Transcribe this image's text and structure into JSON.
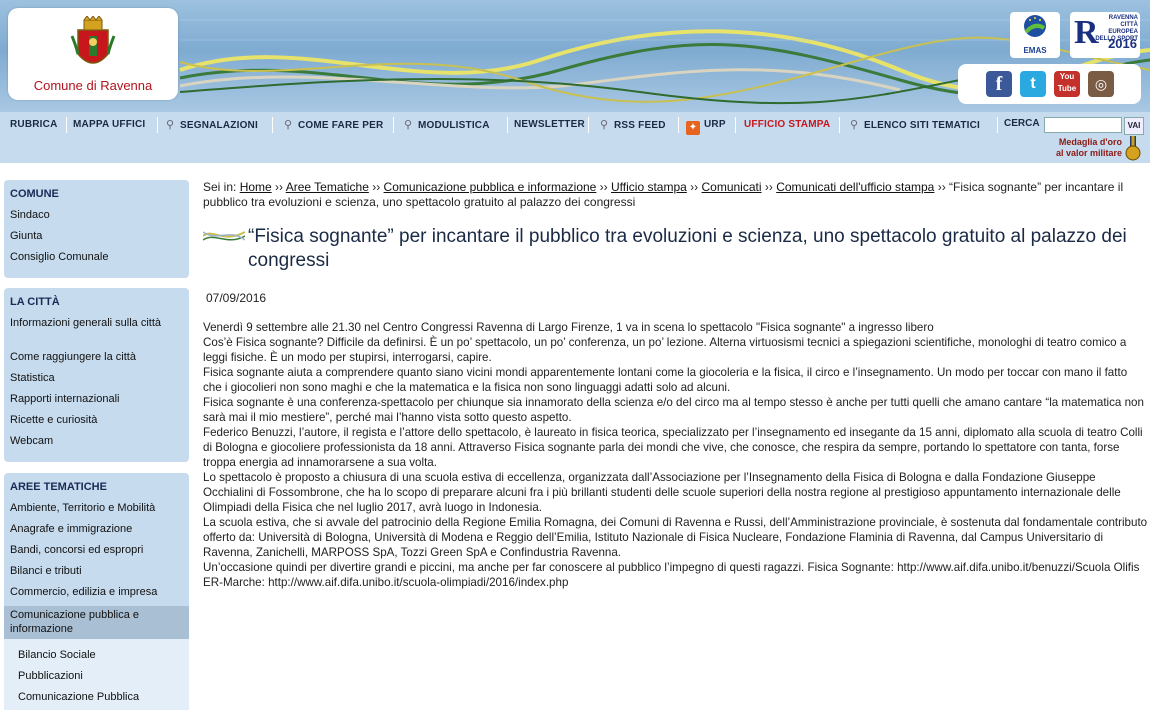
{
  "header": {
    "logo_text": "Comune di Ravenna",
    "emas_label": "EMAS",
    "sport_logo_text": "RAVENNA CITTÀ EUROPEA DELLO SPORT",
    "sport_logo_year": "2016",
    "social": {
      "facebook": "f",
      "twitter": "t",
      "youtube": "You Tube",
      "instagram": "◎"
    }
  },
  "nav": {
    "items": [
      {
        "label": "RUBRICA"
      },
      {
        "label": "MAPPA UFFICI"
      },
      {
        "label": "SEGNALAZIONI"
      },
      {
        "label": "COME FARE PER"
      },
      {
        "label": "MODULISTICA"
      },
      {
        "label": "NEWSLETTER"
      },
      {
        "label": "RSS FEED"
      },
      {
        "label": "URP"
      },
      {
        "label": "UFFICIO STAMPA"
      },
      {
        "label": "ELENCO SITI TEMATICI"
      }
    ],
    "search_label": "CERCA",
    "search_button": "VAI",
    "medaglia_line1": "Medaglia d'oro",
    "medaglia_line2": "al valor militare"
  },
  "sidebar": {
    "comune": {
      "heading": "COMUNE",
      "items": [
        "Sindaco",
        "Giunta",
        "Consiglio Comunale"
      ]
    },
    "citta": {
      "heading": "LA CITTÀ",
      "items": [
        "Informazioni generali sulla città",
        "Come raggiungere la città",
        "Statistica",
        "Rapporti internazionali",
        "Ricette e curiosità",
        "Webcam"
      ]
    },
    "aree": {
      "heading": "AREE TEMATICHE",
      "items": [
        "Ambiente, Territorio e Mobilità",
        "Anagrafe e immigrazione",
        "Bandi, concorsi ed espropri",
        "Bilanci e tributi",
        "Commercio, edilizia e impresa",
        "Comunicazione pubblica e informazione"
      ],
      "subitems": [
        "Bilancio Sociale",
        "Pubblicazioni",
        "Comunicazione Pubblica"
      ]
    }
  },
  "breadcrumb": {
    "prefix": "Sei in:",
    "links": [
      "Home",
      "Aree Tematiche",
      "Comunicazione pubblica e informazione",
      "Ufficio stampa",
      "Comunicati",
      "Comunicati dell'ufficio stampa"
    ],
    "current": "“Fisica sognante” per incantare il pubblico tra evoluzioni e scienza, uno spettacolo gratuito al palazzo dei congressi"
  },
  "article": {
    "title": "“Fisica sognante” per incantare il pubblico tra evoluzioni e scienza, uno spettacolo gratuito al palazzo dei congressi",
    "date": "07/09/2016",
    "paragraphs": [
      "Venerdì 9 settembre alle 21.30 nel Centro Congressi Ravenna di Largo Firenze, 1 va in scena lo spettacolo \"Fisica sognante\" a ingresso libero",
      "Cos’è Fisica sognante? Difficile da definirsi. È un po’ spettacolo, un po’ conferenza, un po’ lezione. Alterna virtuosismi tecnici a spiegazioni scientifiche, monologhi di teatro comico a leggi fisiche. È un modo per stupirsi, interrogarsi, capire.",
      "Fisica sognante aiuta a comprendere quanto siano vicini mondi apparentemente lontani come la giocoleria e la fisica, il circo e l’insegnamento. Un modo per toccar con mano il fatto che i giocolieri non sono maghi e che la matematica e la fisica non sono linguaggi adatti solo ad alcuni.",
      "Fisica sognante è una conferenza-spettacolo per chiunque sia innamorato della scienza e/o del circo ma al tempo stesso è anche per tutti quelli che amano cantare “la matematica non sarà mai il mio mestiere”, perché mai l’hanno vista sotto questo aspetto.",
      "Federico Benuzzi, l’autore, il regista e l’attore dello spettacolo, è laureato in fisica teorica, specializzato per l’insegnamento ed insegante da 15 anni, diplomato alla scuola di teatro Colli di Bologna e giocoliere professionista da 18 anni. Attraverso Fisica sognante parla dei mondi che vive, che conosce, che respira da sempre, portando lo spettatore con tanta, forse troppa energia ad innamorarsene a sua volta.",
      "Lo spettacolo è proposto a chiusura di una scuola estiva di eccellenza, organizzata dall’Associazione per l’Insegnamento della Fisica di Bologna e dalla Fondazione Giuseppe Occhialini di Fossombrone, che ha lo scopo di preparare alcuni fra i più brillanti studenti delle scuole superiori della nostra regione al prestigioso appuntamento internazionale delle Olimpiadi della Fisica che nel luglio 2017, avrà luogo in Indonesia.",
      "La scuola estiva, che si avvale del patrocinio della Regione Emilia Romagna, dei Comuni di Ravenna e Russi, dell’Amministrazione provinciale, è sostenuta dal fondamentale contributo offerto da: Università di Bologna, Università di Modena e Reggio dell’Emilia, Istituto Nazionale di Fisica Nucleare, Fondazione Flaminia di Ravenna, dal Campus Universitario di Ravenna, Zanichelli, MARPOSS SpA, Tozzi Green SpA e Confindustria Ravenna.",
      "Un’occasione quindi per divertire grandi e piccini, ma anche per far conoscere al pubblico l’impegno di questi ragazzi. Fisica Sognante: http://www.aif.difa.unibo.it/benuzzi/Scuola Olifis ER-Marche: http://www.aif.difa.unibo.it/scuola-olimpiadi/2016/index.php"
    ]
  }
}
